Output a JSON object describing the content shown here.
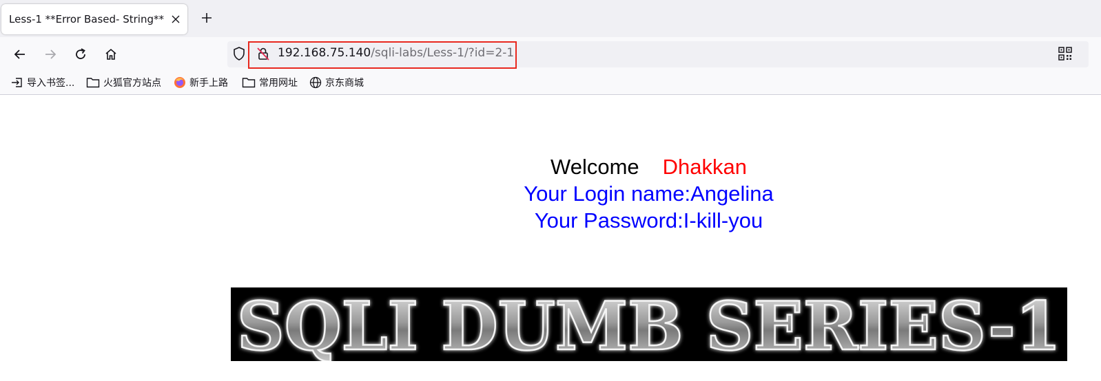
{
  "tab": {
    "title": "Less-1 **Error Based- String**"
  },
  "navigation": {
    "url_host": "192.168.75.140",
    "url_path": "/sqli-labs/Less-1/?id=2-1"
  },
  "bookmarks": [
    {
      "label": "导入书签...",
      "icon": "import-icon"
    },
    {
      "label": "火狐官方站点",
      "icon": "folder-icon"
    },
    {
      "label": "新手上路",
      "icon": "firefox-icon"
    },
    {
      "label": "常用网址",
      "icon": "folder-icon"
    },
    {
      "label": "京东商城",
      "icon": "globe-icon"
    }
  ],
  "page": {
    "welcome": "Welcome",
    "user_word": "Dhakkan",
    "login_line": "Your Login name:Angelina",
    "password_line": "Your Password:I-kill-you",
    "banner_text": "SQLI DUMB SERIES-1"
  },
  "colors": {
    "highlight_border": "#e8281e",
    "welcome_name": "#ff0000",
    "info_text": "#0000ff"
  }
}
